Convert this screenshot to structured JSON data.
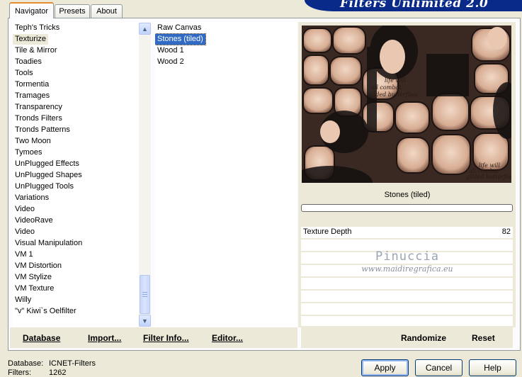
{
  "banner": {
    "title": "Filters Unlimited 2.0"
  },
  "tabs": [
    {
      "label": "Navigator",
      "active": true
    },
    {
      "label": "Presets",
      "active": false
    },
    {
      "label": "About",
      "active": false
    }
  ],
  "categories": [
    "Teph's Tricks",
    "Texturize",
    "Tile & Mirror",
    "Toadies",
    "Tools",
    "Tormentia",
    "Tramages",
    "Transparency",
    "Tronds Filters",
    "Tronds Patterns",
    "Two Moon",
    "Tymoes",
    "UnPlugged Effects",
    "UnPlugged Shapes",
    "UnPlugged Tools",
    "Variations",
    "Video",
    "VideoRave",
    "Video",
    "Visual Manipulation",
    "VM 1",
    "VM Distortion",
    "VM Stylize",
    "VM Texture",
    "Willy",
    "\"v\" Kiwi`s Oelfilter"
  ],
  "selected_category": "Texturize",
  "filters": [
    "Raw Canvas",
    "Stones (tiled)",
    "Wood 1",
    "Wood 2"
  ],
  "selected_filter": "Stones (tiled)",
  "left_buttons": {
    "database": "Database",
    "import": "Import...",
    "filter_info": "Filter Info...",
    "editor": "Editor..."
  },
  "preview": {
    "filter_name": "Stones (tiled)",
    "caption_lines": [
      "life will",
      "all combat",
      "gilded butterflies"
    ],
    "watermark_name": "Pinuccia",
    "watermark_url": "www.maidiregrafica.eu"
  },
  "params": [
    {
      "label": "Texture Depth",
      "value": "82"
    }
  ],
  "right_buttons": {
    "randomize": "Randomize",
    "reset": "Reset"
  },
  "status": {
    "database_label": "Database:",
    "database_value": "ICNET-Filters",
    "filters_label": "Filters:",
    "filters_value": "1262"
  },
  "dialog_buttons": {
    "apply": "Apply",
    "cancel": "Cancel",
    "help": "Help"
  },
  "colors": {
    "banner": "#0a2a8a",
    "selection": "#316ac5",
    "face": "#ece9d8",
    "tab_accent": "#e68b2c"
  }
}
